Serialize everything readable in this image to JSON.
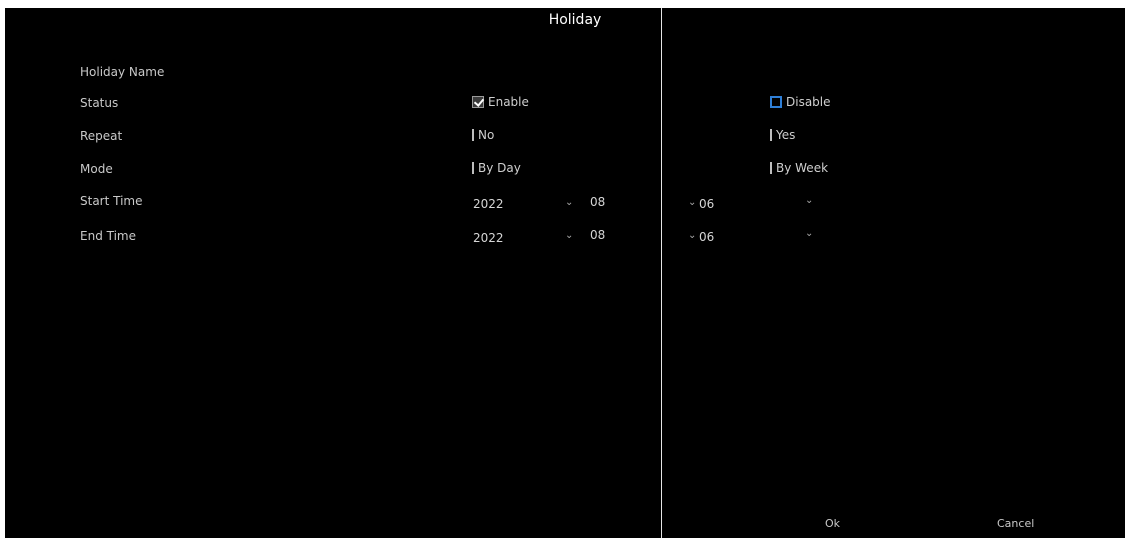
{
  "dialog": {
    "title": "Holiday"
  },
  "labels": {
    "holiday_name": "Holiday Name",
    "status": "Status",
    "repeat": "Repeat",
    "mode": "Mode",
    "start_time": "Start Time",
    "end_time": "End Time"
  },
  "status": {
    "enable_label": "Enable",
    "disable_label": "Disable"
  },
  "repeat": {
    "no_label": "No",
    "yes_label": "Yes"
  },
  "mode": {
    "by_day_label": "By Day",
    "by_week_label": "By Week"
  },
  "start_time": {
    "year": "2022",
    "month": "08",
    "day": "06"
  },
  "end_time": {
    "year": "2022",
    "month": "08",
    "day": "06"
  },
  "footer": {
    "ok_label": "Ok",
    "cancel_label": "Cancel"
  }
}
